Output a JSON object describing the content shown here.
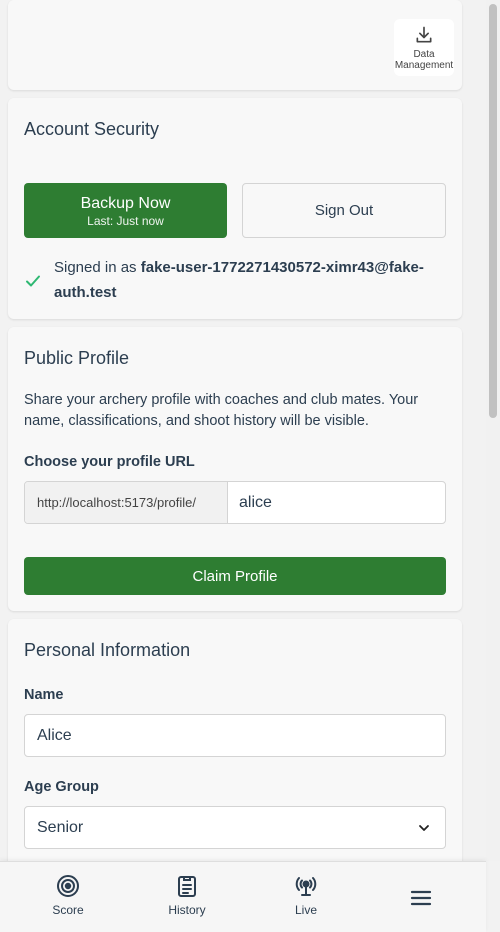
{
  "header": {
    "data_management_label": "Data Management"
  },
  "account_security": {
    "title": "Account Security",
    "backup_label": "Backup Now",
    "backup_sublabel": "Last: Just now",
    "signout_label": "Sign Out",
    "signed_in_prefix": "Signed in as",
    "signed_in_email": "fake-user-1772271430572-ximr43@fake-auth.test"
  },
  "public_profile": {
    "title": "Public Profile",
    "description": "Share your archery profile with coaches and club mates. Your name, classifications, and shoot history will be visible.",
    "url_label": "Choose your profile URL",
    "url_prefix": "http://localhost:5173/profile/",
    "url_value": "alice",
    "claim_label": "Claim Profile"
  },
  "personal_information": {
    "title": "Personal Information",
    "name_label": "Name",
    "name_value": "Alice",
    "age_group_label": "Age Group",
    "age_group_value": "Senior"
  },
  "bottom_nav": {
    "items": [
      {
        "label": "Score",
        "icon": "target-icon"
      },
      {
        "label": "History",
        "icon": "clipboard-icon"
      },
      {
        "label": "Live",
        "icon": "broadcast-icon"
      },
      {
        "label": "",
        "icon": "menu-icon"
      }
    ]
  },
  "colors": {
    "primary_green": "#2e7d32",
    "check_green": "#2eb872",
    "text": "#2c3e50"
  }
}
